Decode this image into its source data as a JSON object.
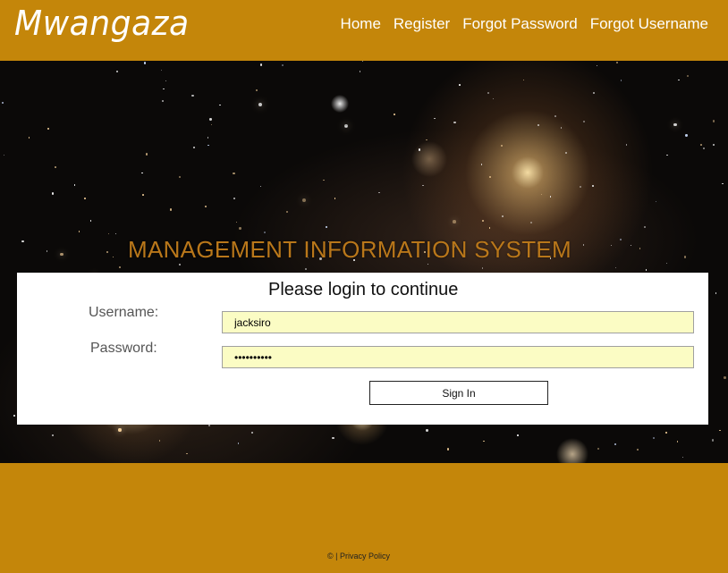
{
  "header": {
    "brand": "Mwangaza",
    "nav": [
      "Home",
      "Register",
      "Forgot Password",
      "Forgot Username"
    ]
  },
  "hero": {
    "title": "MANAGEMENT INFORMATION SYSTEM"
  },
  "login": {
    "heading": "Please login to continue",
    "username_label": "Username:",
    "password_label": "Password:",
    "username_value": "jacksiro",
    "password_value": "••••••••••",
    "signin_label": "Sign In"
  },
  "footer": {
    "text": "© | Privacy Policy"
  },
  "colors": {
    "accent": "#c4860a",
    "title": "#b9771a",
    "input_bg": "#fbfcc4"
  }
}
